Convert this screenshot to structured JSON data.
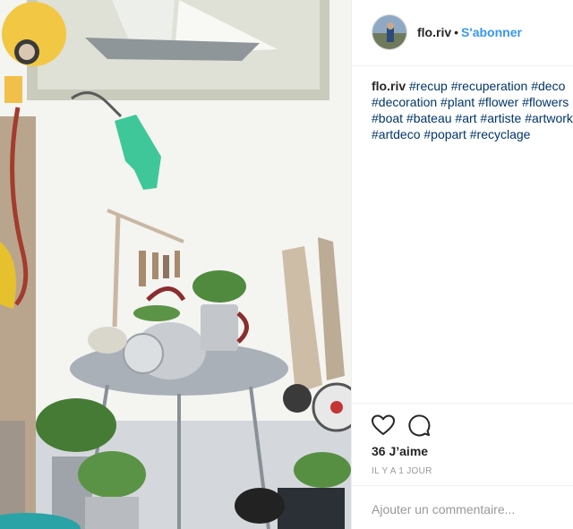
{
  "post": {
    "username": "flo.riv",
    "separator": "•",
    "follow_label": "S'abonner",
    "caption_user": "flo.riv",
    "caption_lines": [
      "#recup #recuperation #deco",
      "#decoration #plant #flower #flowers",
      "#boat #bateau #art #artiste #artwork",
      "#artdeco #popart #recyclage"
    ],
    "likes": "36 J’aime",
    "time": "IL Y A 1 JOUR",
    "comment_placeholder": "Ajouter un commentaire..."
  },
  "icons": {
    "like": "heart-icon",
    "comment": "comment-bubble-icon"
  },
  "colors": {
    "follow": "#3897f0",
    "hashtag": "#003569",
    "muted": "#999999"
  }
}
